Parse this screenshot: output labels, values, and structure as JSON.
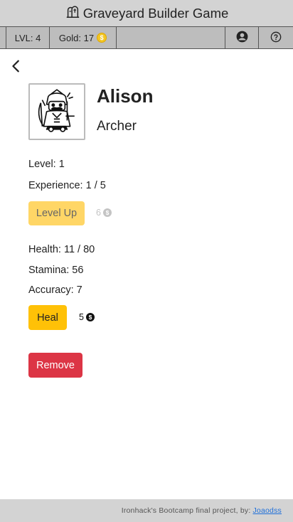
{
  "header": {
    "title": "Graveyard Builder Game",
    "logo_icon": "tombstone-logo-icon"
  },
  "status": {
    "level": "LVL: 4",
    "gold": "Gold: 17",
    "gold_icon": "gold-coin-icon",
    "coin_glyph": "$",
    "profile_icon": "user-circle-icon",
    "help_icon": "help-circle-icon"
  },
  "character": {
    "name": "Alison",
    "class": "Archer",
    "portrait_icon": "archer-portrait-icon",
    "level": "Level: 1",
    "experience": "Experience: 1 / 5",
    "health": "Health: 11 / 80",
    "stamina": "Stamina: 56",
    "accuracy": "Accuracy: 7"
  },
  "actions": {
    "level_up_label": "Level Up",
    "level_up_cost": "6",
    "heal_label": "Heal",
    "heal_cost": "5",
    "remove_label": "Remove",
    "cost_glyph": "$"
  },
  "footer": {
    "text": "Ironhack's Bootcamp final project, by:",
    "author_link": "Joaodss"
  },
  "colors": {
    "header_bg": "#d3d3d3",
    "statusbar_bg": "#bdbdbd",
    "level_up_bg": "#ffd666",
    "heal_bg": "#ffc107",
    "remove_bg": "#dc3545",
    "link": "#1e6fd9"
  }
}
